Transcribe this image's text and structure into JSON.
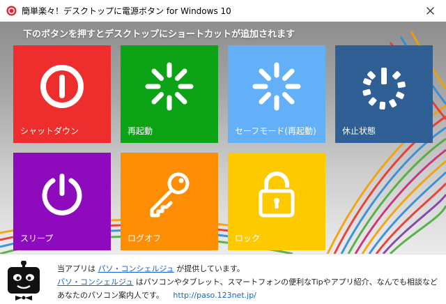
{
  "window": {
    "title": "簡単楽々！デスクトップに電源ボタン for Windows 10"
  },
  "heading": "下のボタンを押すとデスクトップにショートカットが追加されます",
  "tiles": [
    {
      "label": "シャットダウン",
      "color": "#ee2d2d",
      "icon": "power-off-icon"
    },
    {
      "label": "再起動",
      "color": "#0da316",
      "icon": "restart-icon"
    },
    {
      "label": "セーフモード(再起動)",
      "color": "#63b0f8",
      "icon": "safe-mode-icon"
    },
    {
      "label": "休止状態",
      "color": "#2f5f94",
      "icon": "hibernate-icon"
    },
    {
      "label": "スリープ",
      "color": "#8e0bbd",
      "icon": "sleep-icon"
    },
    {
      "label": "ログオフ",
      "color": "#fd8d03",
      "icon": "key-icon"
    },
    {
      "label": "ロック",
      "color": "#fdca00",
      "icon": "padlock-icon"
    }
  ],
  "footer": {
    "line1_prefix": "当アプリは",
    "line1_link": "パソ・コンシェルジュ",
    "line1_suffix": "が提供しています。",
    "line2_link": "パソ・コンシェルジュ",
    "line2_suffix": "はパソコンやタブレット、スマートフォンの便利なTipやアプリ紹介、なんでも相談など",
    "line3_text": "あなたのパソコン案内人です。",
    "url": "http://paso.123net.jp/"
  }
}
